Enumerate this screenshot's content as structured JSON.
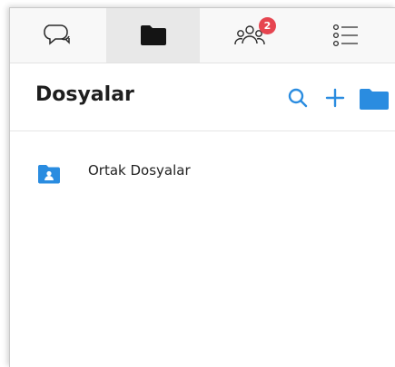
{
  "tabs": [
    {
      "name": "chat",
      "icon": "chat-bubbles-icon",
      "active": false
    },
    {
      "name": "files",
      "icon": "folder-icon",
      "active": true
    },
    {
      "name": "contacts",
      "icon": "people-icon",
      "active": false,
      "badge": "2"
    },
    {
      "name": "tasks",
      "icon": "list-icon",
      "active": false
    }
  ],
  "header": {
    "title": "Dosyalar",
    "actions": [
      {
        "icon": "search-icon"
      },
      {
        "icon": "plus-icon"
      },
      {
        "icon": "folder-icon"
      }
    ]
  },
  "files": {
    "items": [
      {
        "label": "Ortak Dosyalar",
        "icon": "shared-folder-icon"
      }
    ]
  },
  "colors": {
    "accent": "#2a8ce0",
    "badge": "#e64550",
    "tab_active_bg": "#e8e8e8",
    "title_text": "#1e1e1e"
  }
}
